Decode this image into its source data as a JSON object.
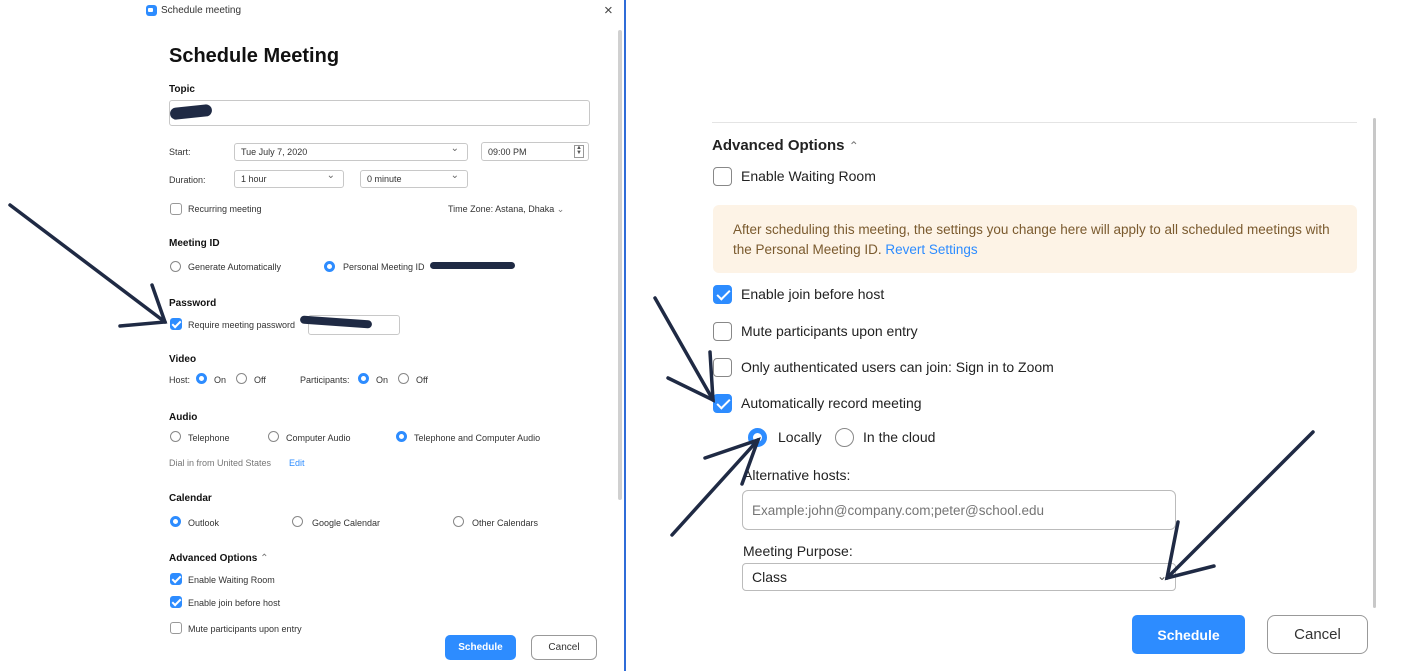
{
  "left": {
    "window_title": "Schedule meeting",
    "close": "×",
    "heading": "Schedule Meeting",
    "topic_label": "Topic",
    "start_label": "Start:",
    "start_date": "Tue July 7, 2020",
    "start_time": "09:00 PM",
    "duration_label": "Duration:",
    "duration_hours": "1 hour",
    "duration_minutes": "0 minute",
    "recurring": "Recurring meeting",
    "timezone": "Time Zone: Astana, Dhaka",
    "meeting_id_label": "Meeting ID",
    "generate_auto": "Generate Automatically",
    "personal_id": "Personal Meeting ID",
    "password_label": "Password",
    "require_password": "Require meeting password",
    "video_label": "Video",
    "host": "Host:",
    "on": "On",
    "off": "Off",
    "participants": "Participants:",
    "audio_label": "Audio",
    "telephone": "Telephone",
    "computer_audio": "Computer Audio",
    "tel_and_computer": "Telephone and Computer Audio",
    "dial_in": "Dial in from United States",
    "edit": "Edit",
    "calendar_label": "Calendar",
    "outlook": "Outlook",
    "google_calendar": "Google Calendar",
    "other_calendars": "Other Calendars",
    "advanced_options": "Advanced Options",
    "enable_waiting_room": "Enable Waiting Room",
    "enable_join_before_host": "Enable join before host",
    "mute_upon_entry": "Mute participants upon entry",
    "schedule": "Schedule",
    "cancel": "Cancel"
  },
  "right": {
    "advanced_options": "Advanced Options",
    "enable_waiting_room": "Enable Waiting Room",
    "notice_text": "After scheduling this meeting, the settings you change here will apply to all scheduled meetings with the Personal Meeting ID.",
    "revert_settings": "Revert Settings",
    "enable_join_before_host": "Enable join before host",
    "mute_upon_entry": "Mute participants upon entry",
    "authenticated_only": "Only authenticated users can join: Sign in to Zoom",
    "auto_record": "Automatically record meeting",
    "locally": "Locally",
    "in_the_cloud": "In the cloud",
    "alternative_hosts_label": "Alternative hosts:",
    "alternative_hosts_placeholder": "Example:john@company.com;peter@school.edu",
    "meeting_purpose_label": "Meeting Purpose:",
    "meeting_purpose_value": "Class",
    "schedule": "Schedule",
    "cancel": "Cancel"
  },
  "colors": {
    "accent": "#2d8cff",
    "arrow": "#1f2a44",
    "notice_bg": "#fdf3e6"
  }
}
